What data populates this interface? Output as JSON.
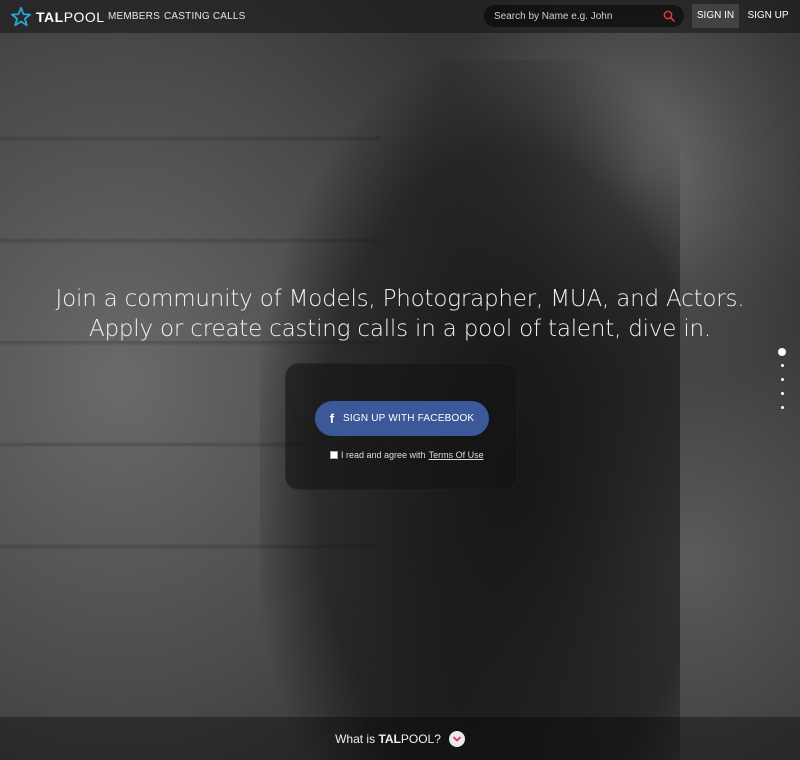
{
  "brand": {
    "name_bold": "TAL",
    "name_light": "POOL",
    "accent_color": "#2aa3d8"
  },
  "nav": {
    "links": [
      "MEMBERS",
      "CASTING CALLS"
    ]
  },
  "search": {
    "placeholder": "Search by Name e.g. John",
    "icon": "search-icon",
    "icon_color": "#e0384a"
  },
  "auth": {
    "signin_label": "SIGN IN",
    "signup_label": "SIGN UP"
  },
  "hero": {
    "line1": "Join a community of Models, Photographer, MUA, and Actors.",
    "line2": "Apply or create casting calls in a pool of talent, dive in."
  },
  "signup_panel": {
    "fb_icon": "f",
    "fb_label": "SIGN UP WITH FACEBOOK",
    "fb_color": "#3b5998",
    "terms_text": "I read and agree with",
    "terms_link": "Terms Of Use"
  },
  "slider": {
    "total": 5,
    "active": 1
  },
  "footer": {
    "whatis_prefix": "What is ",
    "whatis_bold": "TAL",
    "whatis_light": "POOL",
    "whatis_suffix": "?",
    "chevron_color": "#e0384a"
  }
}
